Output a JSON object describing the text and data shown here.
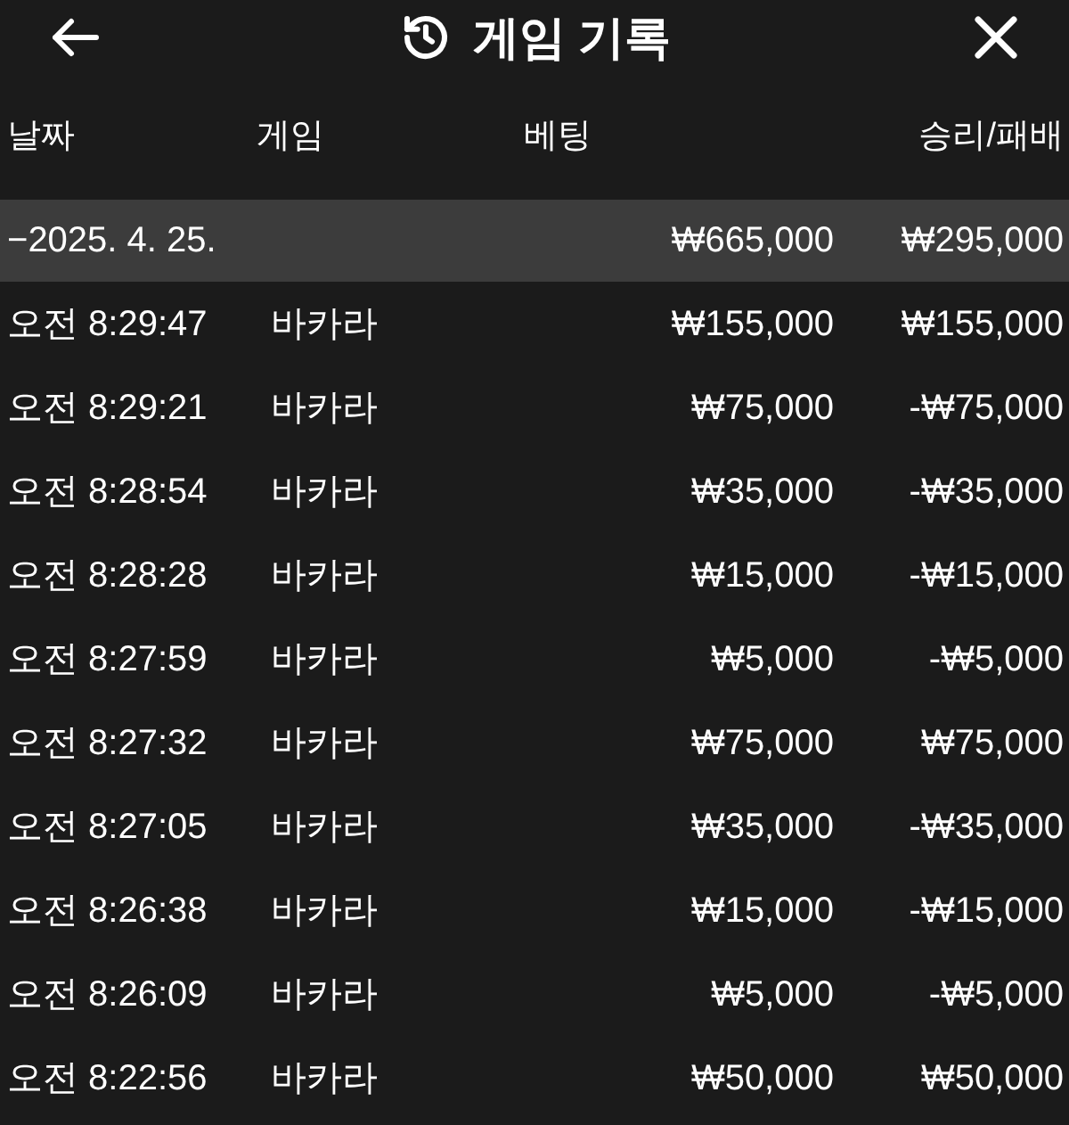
{
  "header": {
    "title": "게임 기록"
  },
  "table": {
    "columns": [
      "날짜",
      "게임",
      "베팅",
      "승리/패배"
    ],
    "group": {
      "expanded": true,
      "toggle": "−",
      "date": "2025. 4. 25.",
      "bet": "₩665,000",
      "result": "₩295,000"
    },
    "rows": [
      {
        "time": "오전 8:29:47",
        "game": "바카라",
        "bet": "₩155,000",
        "result": "₩155,000"
      },
      {
        "time": "오전 8:29:21",
        "game": "바카라",
        "bet": "₩75,000",
        "result": "-₩75,000"
      },
      {
        "time": "오전 8:28:54",
        "game": "바카라",
        "bet": "₩35,000",
        "result": "-₩35,000"
      },
      {
        "time": "오전 8:28:28",
        "game": "바카라",
        "bet": "₩15,000",
        "result": "-₩15,000"
      },
      {
        "time": "오전 8:27:59",
        "game": "바카라",
        "bet": "₩5,000",
        "result": "-₩5,000"
      },
      {
        "time": "오전 8:27:32",
        "game": "바카라",
        "bet": "₩75,000",
        "result": "₩75,000"
      },
      {
        "time": "오전 8:27:05",
        "game": "바카라",
        "bet": "₩35,000",
        "result": "-₩35,000"
      },
      {
        "time": "오전 8:26:38",
        "game": "바카라",
        "bet": "₩15,000",
        "result": "-₩15,000"
      },
      {
        "time": "오전 8:26:09",
        "game": "바카라",
        "bet": "₩5,000",
        "result": "-₩5,000"
      },
      {
        "time": "오전 8:22:56",
        "game": "바카라",
        "bet": "₩50,000",
        "result": "₩50,000"
      }
    ]
  }
}
